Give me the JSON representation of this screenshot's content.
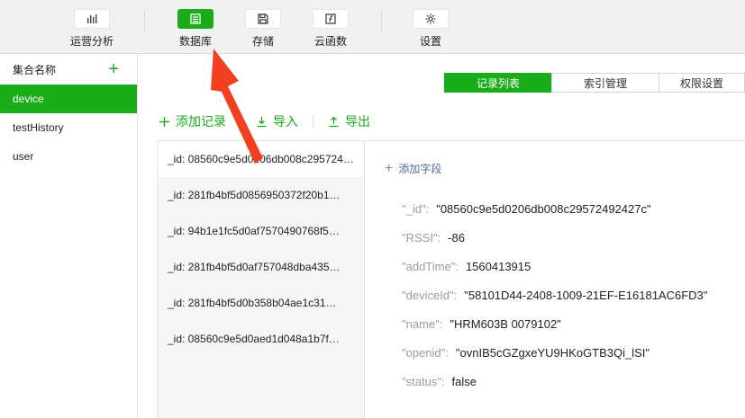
{
  "toolbar": {
    "items": [
      {
        "label": "运营分析",
        "icon": "bar-chart-icon"
      },
      {
        "label": "数据库",
        "icon": "database-icon",
        "active": true
      },
      {
        "label": "存储",
        "icon": "save-icon"
      },
      {
        "label": "云函数",
        "icon": "function-icon"
      },
      {
        "label": "设置",
        "icon": "gear-icon"
      }
    ]
  },
  "sidebar": {
    "title": "集合名称",
    "add_label": "+",
    "collections": [
      "device",
      "testHistory",
      "user"
    ],
    "selected": "device"
  },
  "tabs": [
    "记录列表",
    "索引管理",
    "权限设置"
  ],
  "actions": {
    "add_record": "添加记录",
    "import": "导入",
    "export": "导出"
  },
  "records": [
    "_id: 08560c9e5d0206db008c29572492427c",
    "_id: 281fb4bf5d0856950372f20b1…",
    "_id: 94b1e1fc5d0af7570490768f5…",
    "_id: 281fb4bf5d0af757048dba435…",
    "_id: 281fb4bf5d0b358b04ae1c31…",
    "_id: 08560c9e5d0aed1d048a1b7f…"
  ],
  "detail": {
    "add_field": "添加字段",
    "fields": [
      {
        "key": "\"_id\":",
        "value": "\"08560c9e5d0206db008c29572492427c\""
      },
      {
        "key": "\"RSSI\":",
        "value": "-86"
      },
      {
        "key": "\"addTime\":",
        "value": "1560413915"
      },
      {
        "key": "\"deviceId\":",
        "value": "\"58101D44-2408-1009-21EF-E16181AC6FD3\""
      },
      {
        "key": "\"name\":",
        "value": "\"HRM603B 0079102\""
      },
      {
        "key": "\"openid\":",
        "value": "\"ovnIB5cGZgxeYU9HKoGTB3Qi_lSI\""
      },
      {
        "key": "\"status\":",
        "value": "false"
      }
    ]
  },
  "colors": {
    "accent": "#1aad19",
    "annotation_arrow": "#f0401f",
    "link": "#576b95"
  }
}
